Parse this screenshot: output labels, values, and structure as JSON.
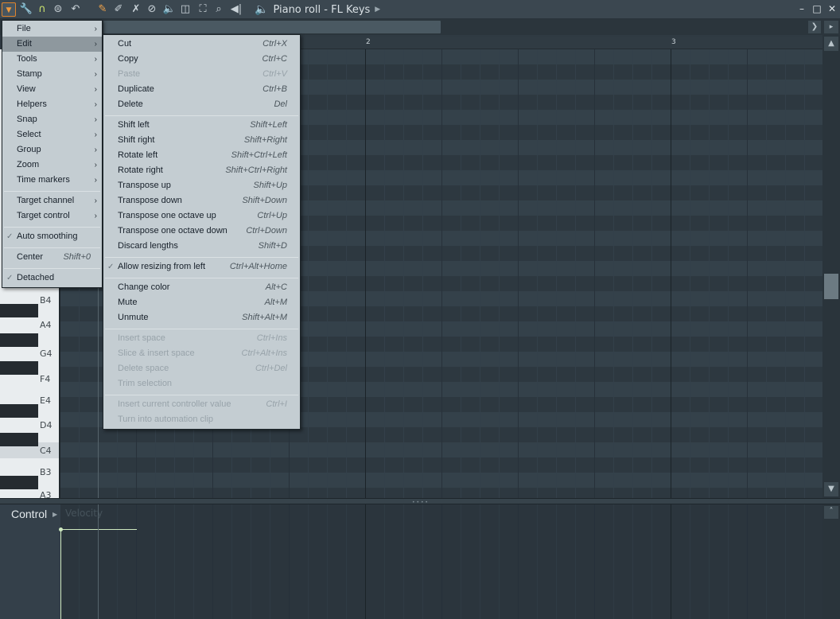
{
  "window": {
    "title": "Piano roll - FL Keys",
    "title_icon": "speaker-icon",
    "controls": [
      "–",
      "□",
      "✕"
    ]
  },
  "ruler": {
    "bar_numbers": [
      "2",
      "3"
    ]
  },
  "piano_keys": {
    "labels": [
      "B4",
      "A4",
      "G4",
      "F4",
      "E4",
      "D4",
      "C4",
      "B3",
      "A3"
    ]
  },
  "control_pane": {
    "label": "Control",
    "parameter": "Velocity"
  },
  "main_menu": {
    "items": [
      {
        "label": "File",
        "submenu": true
      },
      {
        "label": "Edit",
        "submenu": true,
        "selected": true
      },
      {
        "label": "Tools",
        "submenu": true
      },
      {
        "label": "Stamp",
        "submenu": true
      },
      {
        "label": "View",
        "submenu": true
      },
      {
        "label": "Helpers",
        "submenu": true
      },
      {
        "label": "Snap",
        "submenu": true
      },
      {
        "label": "Select",
        "submenu": true
      },
      {
        "label": "Group",
        "submenu": true
      },
      {
        "label": "Zoom",
        "submenu": true
      },
      {
        "label": "Time markers",
        "submenu": true
      },
      {
        "label": "Target channel",
        "submenu": true
      },
      {
        "label": "Target control",
        "submenu": true
      },
      {
        "label": "Auto smoothing",
        "checked": true
      },
      {
        "label": "Center",
        "shortcut": "Shift+0"
      },
      {
        "label": "Detached",
        "checked": true
      }
    ]
  },
  "edit_menu": {
    "items": [
      {
        "label": "Cut",
        "shortcut": "Ctrl+X"
      },
      {
        "label": "Copy",
        "shortcut": "Ctrl+C"
      },
      {
        "label": "Paste",
        "shortcut": "Ctrl+V",
        "disabled": true
      },
      {
        "label": "Duplicate",
        "shortcut": "Ctrl+B"
      },
      {
        "label": "Delete",
        "shortcut": "Del"
      },
      {
        "label": "Shift left",
        "shortcut": "Shift+Left"
      },
      {
        "label": "Shift right",
        "shortcut": "Shift+Right"
      },
      {
        "label": "Rotate left",
        "shortcut": "Shift+Ctrl+Left"
      },
      {
        "label": "Rotate right",
        "shortcut": "Shift+Ctrl+Right"
      },
      {
        "label": "Transpose up",
        "shortcut": "Shift+Up"
      },
      {
        "label": "Transpose down",
        "shortcut": "Shift+Down"
      },
      {
        "label": "Transpose one octave up",
        "shortcut": "Ctrl+Up"
      },
      {
        "label": "Transpose one octave down",
        "shortcut": "Ctrl+Down"
      },
      {
        "label": "Discard lengths",
        "shortcut": "Shift+D"
      },
      {
        "label": "Allow resizing from left",
        "shortcut": "Ctrl+Alt+Home",
        "checked": true
      },
      {
        "label": "Change color",
        "shortcut": "Alt+C"
      },
      {
        "label": "Mute",
        "shortcut": "Alt+M"
      },
      {
        "label": "Unmute",
        "shortcut": "Shift+Alt+M"
      },
      {
        "label": "Insert space",
        "shortcut": "Ctrl+Ins",
        "disabled": true
      },
      {
        "label": "Slice & insert space",
        "shortcut": "Ctrl+Alt+Ins",
        "disabled": true
      },
      {
        "label": "Delete space",
        "shortcut": "Ctrl+Del",
        "disabled": true
      },
      {
        "label": "Trim selection",
        "shortcut": "",
        "disabled": true
      },
      {
        "label": "Insert current controller value",
        "shortcut": "Ctrl+I",
        "disabled": true
      },
      {
        "label": "Turn into automation clip",
        "shortcut": "",
        "disabled": true
      }
    ]
  },
  "colors": {
    "accent": "#e0852d",
    "magnet": "#cde56f",
    "menu_bg": "#c4cdd2",
    "grid": "#34414a"
  }
}
